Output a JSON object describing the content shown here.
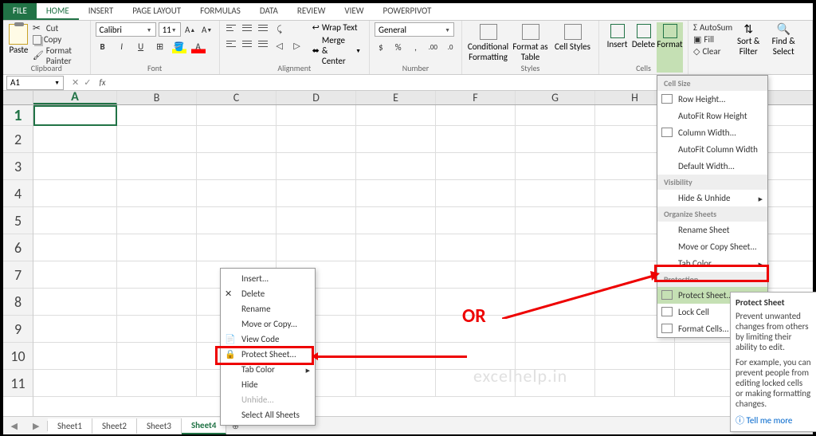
{
  "tabs": {
    "file": "FILE",
    "home": "HOME",
    "insert": "INSERT",
    "pagelayout": "PAGE LAYOUT",
    "formulas": "FORMULAS",
    "data": "DATA",
    "review": "REVIEW",
    "view": "VIEW",
    "powerpivot": "POWERPIVOT"
  },
  "clipboard": {
    "paste": "Paste",
    "cut": "Cut",
    "copy": "Copy",
    "painter": "Format Painter",
    "label": "Clipboard"
  },
  "font": {
    "name": "Calibri",
    "size": "11",
    "label": "Font",
    "bold": "B",
    "italic": "I",
    "underline": "U"
  },
  "alignment": {
    "wrap": "Wrap Text",
    "merge": "Merge & Center",
    "label": "Alignment"
  },
  "number": {
    "format": "General",
    "label": "Number"
  },
  "styles": {
    "cond": "Conditional Formatting",
    "table": "Format as Table",
    "cell": "Cell Styles",
    "label": "Styles"
  },
  "cells": {
    "insert": "Insert",
    "delete": "Delete",
    "format": "Format",
    "label": "Cells"
  },
  "editing": {
    "sum": "AutoSum",
    "fill": "Fill",
    "clear": "Clear",
    "sort": "Sort & Filter",
    "find": "Find & Select"
  },
  "name_box": "A1",
  "columns": [
    "A",
    "B",
    "C",
    "D",
    "E",
    "F",
    "G",
    "H"
  ],
  "rows": [
    "1",
    "2",
    "3",
    "4",
    "5",
    "6",
    "7",
    "8",
    "9",
    "10",
    "11"
  ],
  "sheets": [
    "Sheet1",
    "Sheet2",
    "Sheet3",
    "Sheet4"
  ],
  "active_sheet": "Sheet4",
  "ctx": {
    "insert": "Insert...",
    "delete": "Delete",
    "rename": "Rename",
    "move": "Move or Copy...",
    "viewcode": "View Code",
    "protect": "Protect Sheet...",
    "tabcolor": "Tab Color",
    "hide": "Hide",
    "unhide": "Unhide...",
    "selectall": "Select All Sheets"
  },
  "fmt": {
    "cellsize": "Cell Size",
    "rowheight": "Row Height...",
    "autorow": "AutoFit Row Height",
    "colwidth": "Column Width...",
    "autocol": "AutoFit Column Width",
    "defwidth": "Default Width...",
    "visibility": "Visibility",
    "hideunhide": "Hide & Unhide",
    "organize": "Organize Sheets",
    "renamesheet": "Rename Sheet",
    "movesheet": "Move or Copy Sheet...",
    "tabcolor": "Tab Color",
    "protection": "Protection",
    "protectsheet": "Protect Sheet...",
    "lockcell": "Lock Cell",
    "formatcells": "Format Cells..."
  },
  "tooltip": {
    "title": "Protect Sheet",
    "body1": "Prevent unwanted changes from others by limiting their ability to edit.",
    "body2": "For example, you can prevent people from editing locked cells or making formatting changes.",
    "link": "Tell me more"
  },
  "annot": {
    "or": "OR"
  },
  "watermark": "excelhelp.in"
}
